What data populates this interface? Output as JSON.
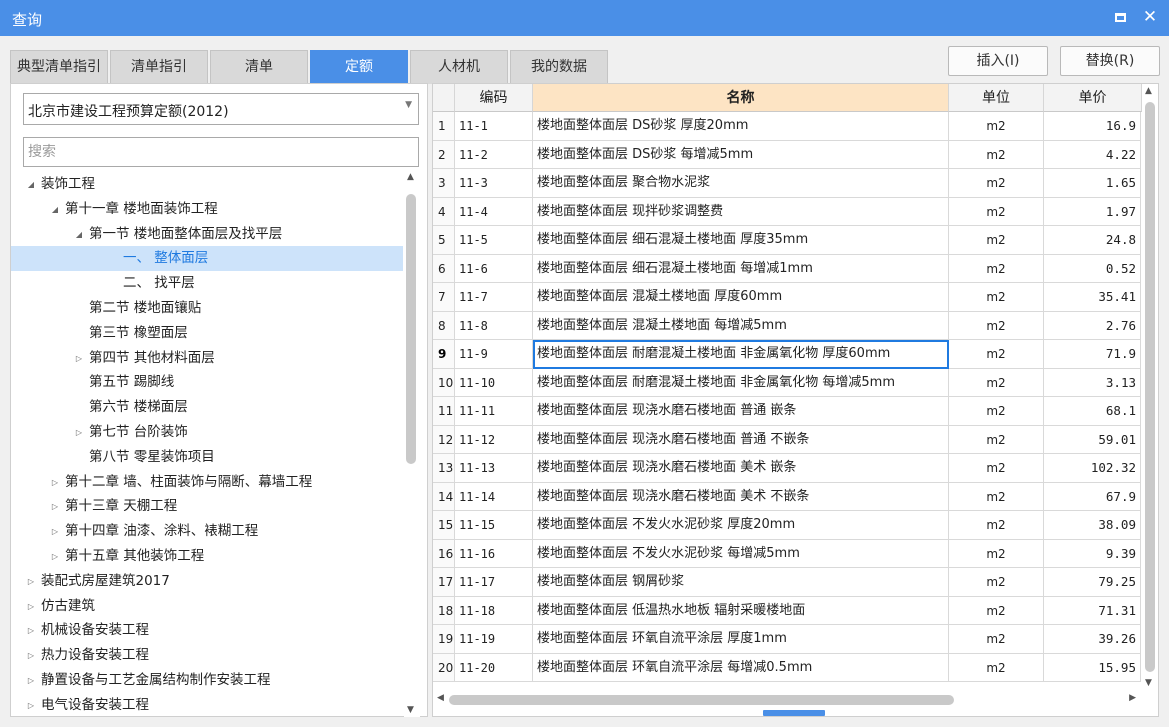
{
  "window": {
    "title": "查询"
  },
  "tabs": [
    {
      "label": "典型清单指引",
      "active": false
    },
    {
      "label": "清单指引",
      "active": false
    },
    {
      "label": "清单",
      "active": false
    },
    {
      "label": "定额",
      "active": true
    },
    {
      "label": "人材机",
      "active": false
    },
    {
      "label": "我的数据",
      "active": false
    }
  ],
  "actions": {
    "insert": "插入(I)",
    "replace": "替换(R)"
  },
  "library": {
    "selected": "北京市建设工程预算定额(2012)"
  },
  "search": {
    "placeholder": "搜索"
  },
  "tree": [
    {
      "label": "装饰工程",
      "level": 0,
      "arrow": "expanded"
    },
    {
      "label": "第十一章 楼地面装饰工程",
      "level": 1,
      "arrow": "expanded"
    },
    {
      "label": "第一节 楼地面整体面层及找平层",
      "level": 2,
      "arrow": "expanded"
    },
    {
      "label": "一、 整体面层",
      "level": 3,
      "arrow": "none",
      "selected": true
    },
    {
      "label": "二、 找平层",
      "level": 3,
      "arrow": "none"
    },
    {
      "label": "第二节 楼地面镶贴",
      "level": 2,
      "arrow": "none"
    },
    {
      "label": "第三节 橡塑面层",
      "level": 2,
      "arrow": "none"
    },
    {
      "label": "第四节 其他材料面层",
      "level": 2,
      "arrow": "collapsed"
    },
    {
      "label": "第五节 踢脚线",
      "level": 2,
      "arrow": "none"
    },
    {
      "label": "第六节 楼梯面层",
      "level": 2,
      "arrow": "none"
    },
    {
      "label": "第七节 台阶装饰",
      "level": 2,
      "arrow": "collapsed"
    },
    {
      "label": "第八节 零星装饰项目",
      "level": 2,
      "arrow": "none"
    },
    {
      "label": "第十二章 墙、柱面装饰与隔断、幕墙工程",
      "level": 1,
      "arrow": "collapsed"
    },
    {
      "label": "第十三章 天棚工程",
      "level": 1,
      "arrow": "collapsed"
    },
    {
      "label": "第十四章 油漆、涂料、裱糊工程",
      "level": 1,
      "arrow": "collapsed"
    },
    {
      "label": "第十五章 其他装饰工程",
      "level": 1,
      "arrow": "collapsed"
    },
    {
      "label": "装配式房屋建筑2017",
      "level": 0,
      "arrow": "collapsed"
    },
    {
      "label": "仿古建筑",
      "level": 0,
      "arrow": "collapsed"
    },
    {
      "label": "机械设备安装工程",
      "level": 0,
      "arrow": "collapsed"
    },
    {
      "label": "热力设备安装工程",
      "level": 0,
      "arrow": "collapsed"
    },
    {
      "label": "静置设备与工艺金属结构制作安装工程",
      "level": 0,
      "arrow": "collapsed"
    },
    {
      "label": "电气设备安装工程",
      "level": 0,
      "arrow": "collapsed"
    }
  ],
  "table": {
    "headers": {
      "code": "编码",
      "name": "名称",
      "unit": "单位",
      "price": "单价"
    },
    "rows": [
      {
        "idx": "1",
        "code": "11-1",
        "name": "楼地面整体面层 DS砂浆 厚度20mm",
        "unit": "m2",
        "price": "16.9"
      },
      {
        "idx": "2",
        "code": "11-2",
        "name": "楼地面整体面层 DS砂浆 每增减5mm",
        "unit": "m2",
        "price": "4.22"
      },
      {
        "idx": "3",
        "code": "11-3",
        "name": "楼地面整体面层 聚合物水泥浆",
        "unit": "m2",
        "price": "1.65"
      },
      {
        "idx": "4",
        "code": "11-4",
        "name": "楼地面整体面层 现拌砂浆调整费",
        "unit": "m2",
        "price": "1.97"
      },
      {
        "idx": "5",
        "code": "11-5",
        "name": "楼地面整体面层 细石混凝土楼地面 厚度35mm",
        "unit": "m2",
        "price": "24.8"
      },
      {
        "idx": "6",
        "code": "11-6",
        "name": "楼地面整体面层 细石混凝土楼地面 每增减1mm",
        "unit": "m2",
        "price": "0.52"
      },
      {
        "idx": "7",
        "code": "11-7",
        "name": "楼地面整体面层 混凝土楼地面 厚度60mm",
        "unit": "m2",
        "price": "35.41"
      },
      {
        "idx": "8",
        "code": "11-8",
        "name": "楼地面整体面层 混凝土楼地面 每增减5mm",
        "unit": "m2",
        "price": "2.76"
      },
      {
        "idx": "9",
        "code": "11-9",
        "name": "楼地面整体面层 耐磨混凝土楼地面 非金属氧化物 厚度60mm",
        "unit": "m2",
        "price": "71.9",
        "selected": true
      },
      {
        "idx": "10",
        "code": "11-10",
        "name": "楼地面整体面层 耐磨混凝土楼地面 非金属氧化物 每增减5mm",
        "unit": "m2",
        "price": "3.13"
      },
      {
        "idx": "11",
        "code": "11-11",
        "name": "楼地面整体面层 现浇水磨石楼地面 普通 嵌条",
        "unit": "m2",
        "price": "68.1"
      },
      {
        "idx": "12",
        "code": "11-12",
        "name": "楼地面整体面层 现浇水磨石楼地面 普通 不嵌条",
        "unit": "m2",
        "price": "59.01"
      },
      {
        "idx": "13",
        "code": "11-13",
        "name": "楼地面整体面层 现浇水磨石楼地面 美术 嵌条",
        "unit": "m2",
        "price": "102.32"
      },
      {
        "idx": "14",
        "code": "11-14",
        "name": "楼地面整体面层 现浇水磨石楼地面 美术 不嵌条",
        "unit": "m2",
        "price": "67.9"
      },
      {
        "idx": "15",
        "code": "11-15",
        "name": "楼地面整体面层 不发火水泥砂浆 厚度20mm",
        "unit": "m2",
        "price": "38.09"
      },
      {
        "idx": "16",
        "code": "11-16",
        "name": "楼地面整体面层 不发火水泥砂浆 每增减5mm",
        "unit": "m2",
        "price": "9.39"
      },
      {
        "idx": "17",
        "code": "11-17",
        "name": "楼地面整体面层 钢屑砂浆",
        "unit": "m2",
        "price": "79.25"
      },
      {
        "idx": "18",
        "code": "11-18",
        "name": "楼地面整体面层 低温热水地板 辐射采暖楼地面",
        "unit": "m2",
        "price": "71.31"
      },
      {
        "idx": "19",
        "code": "11-19",
        "name": "楼地面整体面层 环氧自流平涂层 厚度1mm",
        "unit": "m2",
        "price": "39.26"
      },
      {
        "idx": "20",
        "code": "11-20",
        "name": "楼地面整体面层 环氧自流平涂层 每增减0.5mm",
        "unit": "m2",
        "price": "15.95"
      }
    ]
  },
  "colors": {
    "accent": "#4a8fe7",
    "header_highlight": "#fde4c4",
    "tree_selected": "#cde3fa"
  }
}
